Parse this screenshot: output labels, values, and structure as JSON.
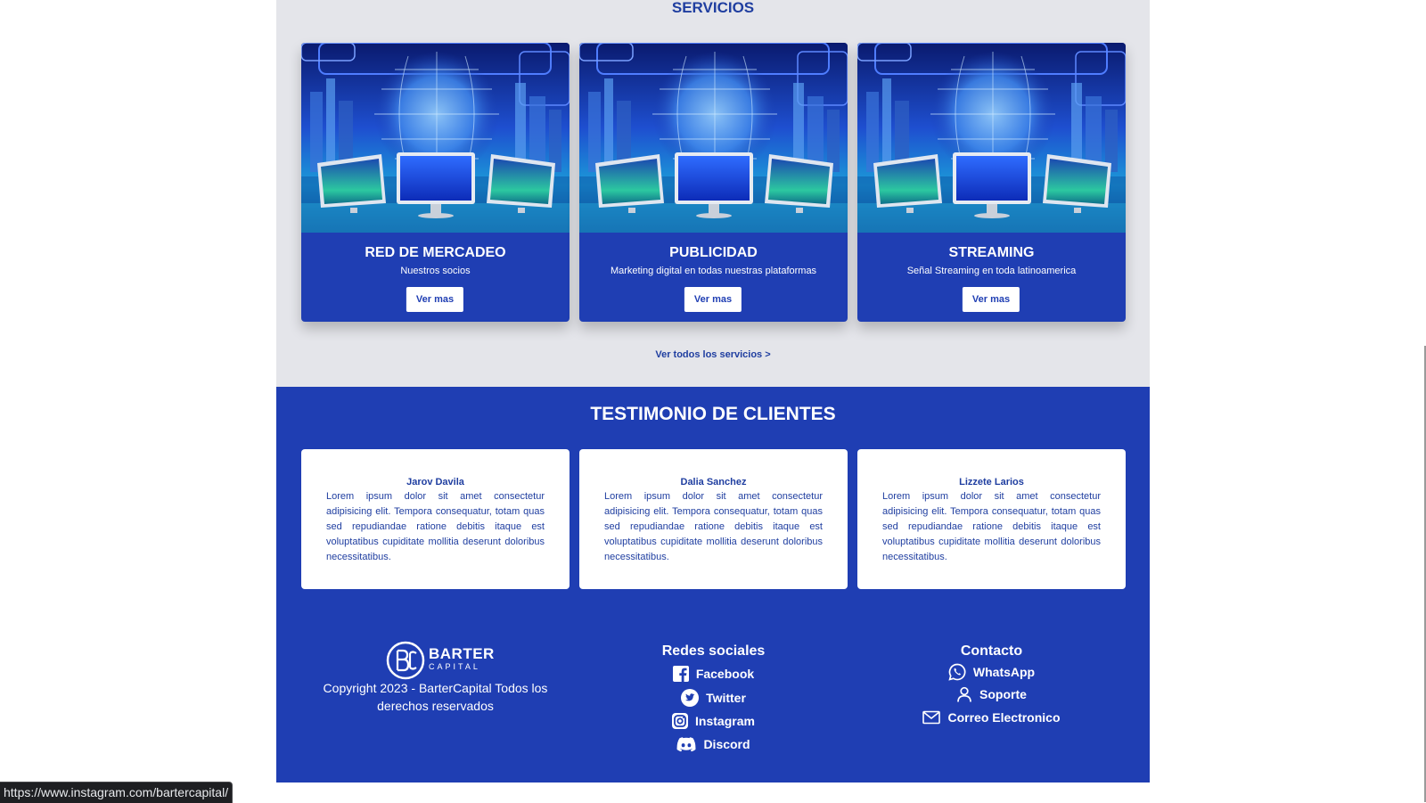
{
  "services": {
    "title": "SERVICIOS",
    "cards": [
      {
        "title": "RED DE MERCADEO",
        "subtitle": "Nuestros socios",
        "button": "Ver mas"
      },
      {
        "title": "PUBLICIDAD",
        "subtitle": "Marketing digital en todas nuestras plataformas",
        "button": "Ver mas"
      },
      {
        "title": "STREAMING",
        "subtitle": "Señal Streaming en toda latinoamerica",
        "button": "Ver mas"
      }
    ],
    "all_link": "Ver todos los servicios >"
  },
  "testimonials": {
    "title": "TESTIMONIO DE CLIENTES",
    "items": [
      {
        "name": "Jarov Davila",
        "text": "Lorem ipsum dolor sit amet consectetur adipisicing elit. Tempora consequatur, totam quas sed repudiandae ratione debitis itaque est voluptatibus cupiditate mollitia deserunt doloribus necessitatibus."
      },
      {
        "name": "Dalia Sanchez",
        "text": "Lorem ipsum dolor sit amet consectetur adipisicing elit. Tempora consequatur, totam quas sed repudiandae ratione debitis itaque est voluptatibus cupiditate mollitia deserunt doloribus necessitatibus."
      },
      {
        "name": "Lizzete Larios",
        "text": "Lorem ipsum dolor sit amet consectetur adipisicing elit. Tempora consequatur, totam quas sed repudiandae ratione debitis itaque est voluptatibus cupiditate mollitia deserunt doloribus necessitatibus."
      }
    ]
  },
  "footer": {
    "logo": {
      "word": "BARTER",
      "sub": "CAPITAL"
    },
    "copyright": "Copyright 2023 - BarterCapital Todos los derechos reservados",
    "social": {
      "title": "Redes sociales",
      "links": [
        {
          "label": "Facebook",
          "icon": "facebook-icon"
        },
        {
          "label": "Twitter",
          "icon": "twitter-icon"
        },
        {
          "label": "Instagram",
          "icon": "instagram-icon"
        },
        {
          "label": "Discord",
          "icon": "discord-icon"
        }
      ]
    },
    "contact": {
      "title": "Contacto",
      "links": [
        {
          "label": "WhatsApp",
          "icon": "whatsapp-icon"
        },
        {
          "label": "Soporte",
          "icon": "user-icon"
        },
        {
          "label": "Correo Electronico",
          "icon": "mail-icon"
        }
      ]
    }
  },
  "status_url": "https://www.instagram.com/bartercapital/",
  "colors": {
    "brand_blue": "#1f3eb3",
    "section_gray": "#e4e5ea",
    "heading_blue": "#1f3ea0"
  }
}
